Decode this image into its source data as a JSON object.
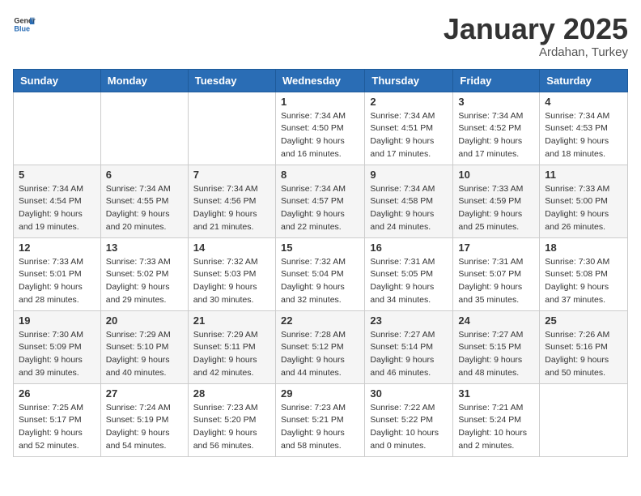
{
  "header": {
    "logo_general": "General",
    "logo_blue": "Blue",
    "month_title": "January 2025",
    "location": "Ardahan, Turkey"
  },
  "weekdays": [
    "Sunday",
    "Monday",
    "Tuesday",
    "Wednesday",
    "Thursday",
    "Friday",
    "Saturday"
  ],
  "weeks": [
    [
      {
        "day": "",
        "info": ""
      },
      {
        "day": "",
        "info": ""
      },
      {
        "day": "",
        "info": ""
      },
      {
        "day": "1",
        "info": "Sunrise: 7:34 AM\nSunset: 4:50 PM\nDaylight: 9 hours\nand 16 minutes."
      },
      {
        "day": "2",
        "info": "Sunrise: 7:34 AM\nSunset: 4:51 PM\nDaylight: 9 hours\nand 17 minutes."
      },
      {
        "day": "3",
        "info": "Sunrise: 7:34 AM\nSunset: 4:52 PM\nDaylight: 9 hours\nand 17 minutes."
      },
      {
        "day": "4",
        "info": "Sunrise: 7:34 AM\nSunset: 4:53 PM\nDaylight: 9 hours\nand 18 minutes."
      }
    ],
    [
      {
        "day": "5",
        "info": "Sunrise: 7:34 AM\nSunset: 4:54 PM\nDaylight: 9 hours\nand 19 minutes."
      },
      {
        "day": "6",
        "info": "Sunrise: 7:34 AM\nSunset: 4:55 PM\nDaylight: 9 hours\nand 20 minutes."
      },
      {
        "day": "7",
        "info": "Sunrise: 7:34 AM\nSunset: 4:56 PM\nDaylight: 9 hours\nand 21 minutes."
      },
      {
        "day": "8",
        "info": "Sunrise: 7:34 AM\nSunset: 4:57 PM\nDaylight: 9 hours\nand 22 minutes."
      },
      {
        "day": "9",
        "info": "Sunrise: 7:34 AM\nSunset: 4:58 PM\nDaylight: 9 hours\nand 24 minutes."
      },
      {
        "day": "10",
        "info": "Sunrise: 7:33 AM\nSunset: 4:59 PM\nDaylight: 9 hours\nand 25 minutes."
      },
      {
        "day": "11",
        "info": "Sunrise: 7:33 AM\nSunset: 5:00 PM\nDaylight: 9 hours\nand 26 minutes."
      }
    ],
    [
      {
        "day": "12",
        "info": "Sunrise: 7:33 AM\nSunset: 5:01 PM\nDaylight: 9 hours\nand 28 minutes."
      },
      {
        "day": "13",
        "info": "Sunrise: 7:33 AM\nSunset: 5:02 PM\nDaylight: 9 hours\nand 29 minutes."
      },
      {
        "day": "14",
        "info": "Sunrise: 7:32 AM\nSunset: 5:03 PM\nDaylight: 9 hours\nand 30 minutes."
      },
      {
        "day": "15",
        "info": "Sunrise: 7:32 AM\nSunset: 5:04 PM\nDaylight: 9 hours\nand 32 minutes."
      },
      {
        "day": "16",
        "info": "Sunrise: 7:31 AM\nSunset: 5:05 PM\nDaylight: 9 hours\nand 34 minutes."
      },
      {
        "day": "17",
        "info": "Sunrise: 7:31 AM\nSunset: 5:07 PM\nDaylight: 9 hours\nand 35 minutes."
      },
      {
        "day": "18",
        "info": "Sunrise: 7:30 AM\nSunset: 5:08 PM\nDaylight: 9 hours\nand 37 minutes."
      }
    ],
    [
      {
        "day": "19",
        "info": "Sunrise: 7:30 AM\nSunset: 5:09 PM\nDaylight: 9 hours\nand 39 minutes."
      },
      {
        "day": "20",
        "info": "Sunrise: 7:29 AM\nSunset: 5:10 PM\nDaylight: 9 hours\nand 40 minutes."
      },
      {
        "day": "21",
        "info": "Sunrise: 7:29 AM\nSunset: 5:11 PM\nDaylight: 9 hours\nand 42 minutes."
      },
      {
        "day": "22",
        "info": "Sunrise: 7:28 AM\nSunset: 5:12 PM\nDaylight: 9 hours\nand 44 minutes."
      },
      {
        "day": "23",
        "info": "Sunrise: 7:27 AM\nSunset: 5:14 PM\nDaylight: 9 hours\nand 46 minutes."
      },
      {
        "day": "24",
        "info": "Sunrise: 7:27 AM\nSunset: 5:15 PM\nDaylight: 9 hours\nand 48 minutes."
      },
      {
        "day": "25",
        "info": "Sunrise: 7:26 AM\nSunset: 5:16 PM\nDaylight: 9 hours\nand 50 minutes."
      }
    ],
    [
      {
        "day": "26",
        "info": "Sunrise: 7:25 AM\nSunset: 5:17 PM\nDaylight: 9 hours\nand 52 minutes."
      },
      {
        "day": "27",
        "info": "Sunrise: 7:24 AM\nSunset: 5:19 PM\nDaylight: 9 hours\nand 54 minutes."
      },
      {
        "day": "28",
        "info": "Sunrise: 7:23 AM\nSunset: 5:20 PM\nDaylight: 9 hours\nand 56 minutes."
      },
      {
        "day": "29",
        "info": "Sunrise: 7:23 AM\nSunset: 5:21 PM\nDaylight: 9 hours\nand 58 minutes."
      },
      {
        "day": "30",
        "info": "Sunrise: 7:22 AM\nSunset: 5:22 PM\nDaylight: 10 hours\nand 0 minutes."
      },
      {
        "day": "31",
        "info": "Sunrise: 7:21 AM\nSunset: 5:24 PM\nDaylight: 10 hours\nand 2 minutes."
      },
      {
        "day": "",
        "info": ""
      }
    ]
  ]
}
